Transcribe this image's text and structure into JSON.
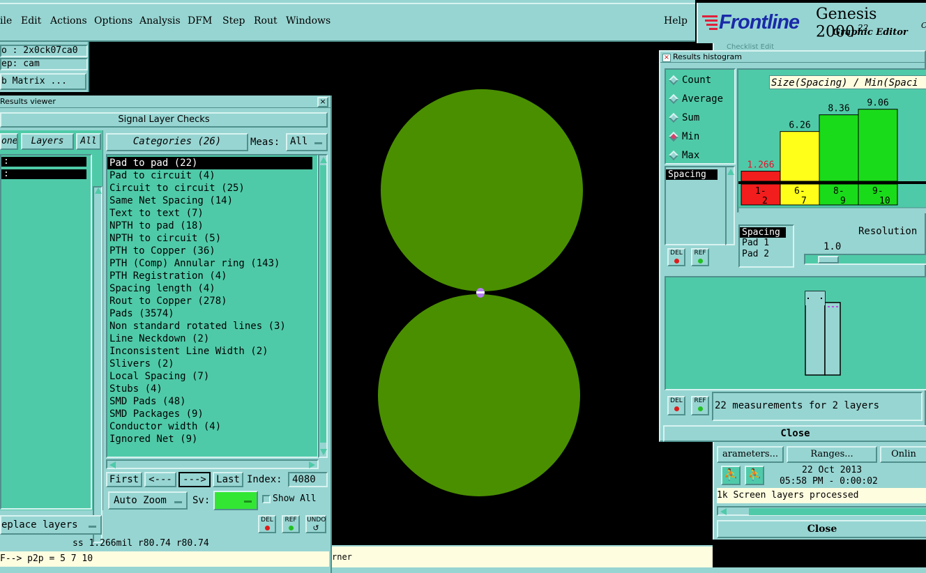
{
  "menubar": {
    "items": [
      "ile",
      "Edit",
      "Actions",
      "Options",
      "Analysis",
      "DFM",
      "Step",
      "Rout",
      "Windows"
    ],
    "help": "Help"
  },
  "brand": {
    "logo": "Frontline",
    "product": "Genesis 2000",
    "version_sup": "22",
    "version_sub": "C",
    "subtitle": "Graphic Editor"
  },
  "left_info": {
    "job_line": "o : 2x0ck07ca0",
    "step_line": "ep: cam",
    "matrix_btn": "b Matrix ..."
  },
  "results_viewer": {
    "title": "Results viewer",
    "header": "Signal Layer Checks",
    "none_btn": "one",
    "layers_btn": "Layers",
    "all_btn": "All",
    "layer_rows": [
      ":",
      ":"
    ],
    "categories_btn": "Categories (26)",
    "meas_label": "Meas:",
    "meas_value": "All",
    "categories": [
      "Pad to pad (22)",
      "Pad to circuit (4)",
      "Circuit to circuit (25)",
      "Same Net Spacing (14)",
      "Text to text (7)",
      "NPTH to pad (18)",
      "NPTH to circuit (5)",
      "PTH to Copper (36)",
      "PTH (Comp) Annular ring (143)",
      "PTH Registration (4)",
      "Spacing length (4)",
      "Rout to Copper (278)",
      "Pads (3574)",
      "Non standard rotated lines (3)",
      "Line Neckdown (2)",
      "Inconsistent Line Width (2)",
      "Slivers (2)",
      "Local Spacing (7)",
      "Stubs (4)",
      "SMD Pads (48)",
      "SMD Packages (9)",
      "Conductor width (4)",
      "Ignored Net (9)"
    ],
    "nav": {
      "first": "First",
      "prev": "<---",
      "next": "--->",
      "last": "Last",
      "index_label": "Index:",
      "index_value": "4080"
    },
    "auto_zoom": "Auto Zoom",
    "sv_label": "Sv:",
    "show_all": "Show All",
    "replace_layers": "eplace layers",
    "del": "DEL",
    "ref": "REF",
    "undo": "UNDO"
  },
  "status": {
    "measure": "ss 1.266mil  r80.74  r80.74",
    "command": "F--> p2p = 5 7 10",
    "bottom_msg": "rner"
  },
  "histogram": {
    "title": "Results histogram",
    "modes": [
      "Count",
      "Average",
      "Sum",
      "Min",
      "Max"
    ],
    "selected_mode": "Min",
    "chart_title": "Size(Spacing) / Min(Spaci",
    "spacing_list": [
      "Spacing"
    ],
    "del": "DEL",
    "ref": "REF",
    "attr_list": [
      "Spacing",
      "Pad 1",
      "Pad 2"
    ],
    "resolution_label": "Resolution",
    "resolution_value": "1.0",
    "summary": "22 measurements for 2 layers",
    "close": "Close"
  },
  "chart_data": {
    "type": "bar",
    "title": "Size(Spacing) / Min(Spaci",
    "categories": [
      "1-2",
      "6-7",
      "8-9",
      "9-10"
    ],
    "category_tops": [
      "1-",
      "6-",
      "8-",
      "9-"
    ],
    "category_bottoms": [
      "2",
      "7",
      "9",
      "10"
    ],
    "values": [
      1.266,
      6.26,
      8.36,
      9.06
    ],
    "value_labels": [
      "1.266",
      "6.26",
      "8.36",
      "9.06"
    ],
    "colors": [
      "#f21d1d",
      "#ffff1a",
      "#1adb1a",
      "#1adb1a"
    ],
    "label_colors": [
      "#e8102a",
      "#000000",
      "#000000",
      "#000000"
    ],
    "ylim": [
      0,
      10
    ]
  },
  "checklist": {
    "partial_title": "Checklist Edit",
    "parameters_btn": "arameters...",
    "ranges_btn": "Ranges...",
    "online_btn": "Onlin",
    "date": "22 Oct 2013",
    "time": "05:58 PM - 0:00:02",
    "msg": "1k Screen layers processed",
    "close": "Close"
  },
  "colors": {
    "motif": "#97d5d2",
    "panel": "#4fcaa8",
    "copper": "#4a8f00",
    "canvas": "#000000"
  }
}
